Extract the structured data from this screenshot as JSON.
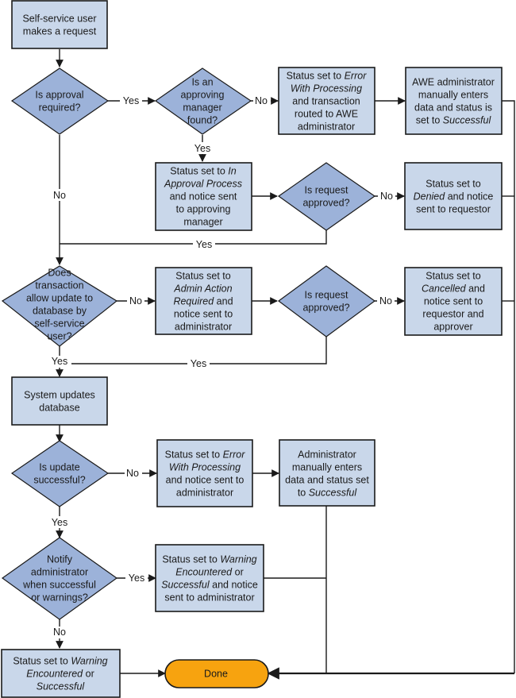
{
  "diagram": {
    "colors": {
      "process_fill": "#c9d7ea",
      "decision_fill": "#9cb2d9",
      "terminal_fill": "#f7a30f",
      "line": "#1a1a1a"
    },
    "nodes": {
      "start": {
        "lines": [
          [
            {
              "t": "Self-service user"
            }
          ],
          [
            {
              "t": "makes a request"
            }
          ]
        ]
      },
      "approval_required": {
        "lines": [
          [
            {
              "t": "Is approval"
            }
          ],
          [
            {
              "t": "required?"
            }
          ]
        ]
      },
      "manager_found": {
        "lines": [
          [
            {
              "t": "Is an"
            }
          ],
          [
            {
              "t": "approving"
            }
          ],
          [
            {
              "t": "manager"
            }
          ],
          [
            {
              "t": "found?"
            }
          ]
        ]
      },
      "error_routed": {
        "lines": [
          [
            {
              "t": "Status set to "
            },
            {
              "t": "Error",
              "i": true
            }
          ],
          [
            {
              "t": "With Processing",
              "i": true
            }
          ],
          [
            {
              "t": "and transaction"
            }
          ],
          [
            {
              "t": "routed to AWE"
            }
          ],
          [
            {
              "t": "administrator"
            }
          ]
        ]
      },
      "awe_admin_enters": {
        "lines": [
          [
            {
              "t": "AWE administrator"
            }
          ],
          [
            {
              "t": "manually enters"
            }
          ],
          [
            {
              "t": "data and status is"
            }
          ],
          [
            {
              "t": "set to "
            },
            {
              "t": "Successful",
              "i": true
            }
          ]
        ]
      },
      "in_approval": {
        "lines": [
          [
            {
              "t": "Status set to "
            },
            {
              "t": "In",
              "i": true
            }
          ],
          [
            {
              "t": "Approval Process",
              "i": true
            }
          ],
          [
            {
              "t": "and notice sent"
            }
          ],
          [
            {
              "t": "to approving"
            }
          ],
          [
            {
              "t": "manager"
            }
          ]
        ]
      },
      "request_approved_1": {
        "lines": [
          [
            {
              "t": "Is request"
            }
          ],
          [
            {
              "t": "approved?"
            }
          ]
        ]
      },
      "denied": {
        "lines": [
          [
            {
              "t": "Status set to"
            }
          ],
          [
            {
              "t": "Denied",
              "i": true
            },
            {
              "t": " and notice"
            }
          ],
          [
            {
              "t": "sent to requestor"
            }
          ]
        ]
      },
      "allow_update": {
        "lines": [
          [
            {
              "t": "Does"
            }
          ],
          [
            {
              "t": "transaction"
            }
          ],
          [
            {
              "t": "allow update to"
            }
          ],
          [
            {
              "t": "database by"
            }
          ],
          [
            {
              "t": "self-service"
            }
          ],
          [
            {
              "t": "user?"
            }
          ]
        ]
      },
      "admin_action": {
        "lines": [
          [
            {
              "t": "Status set to"
            }
          ],
          [
            {
              "t": "Admin Action",
              "i": true
            }
          ],
          [
            {
              "t": "Required",
              "i": true
            },
            {
              "t": " and"
            }
          ],
          [
            {
              "t": "notice sent to"
            }
          ],
          [
            {
              "t": "administrator"
            }
          ]
        ]
      },
      "request_approved_2": {
        "lines": [
          [
            {
              "t": "Is request"
            }
          ],
          [
            {
              "t": "approved?"
            }
          ]
        ]
      },
      "cancelled": {
        "lines": [
          [
            {
              "t": "Status set to"
            }
          ],
          [
            {
              "t": "Cancelled",
              "i": true
            },
            {
              "t": " and"
            }
          ],
          [
            {
              "t": "notice sent to"
            }
          ],
          [
            {
              "t": "requestor and"
            }
          ],
          [
            {
              "t": "approver"
            }
          ]
        ]
      },
      "system_updates": {
        "lines": [
          [
            {
              "t": "System updates"
            }
          ],
          [
            {
              "t": "database"
            }
          ]
        ]
      },
      "update_successful": {
        "lines": [
          [
            {
              "t": "Is update"
            }
          ],
          [
            {
              "t": "successful?"
            }
          ]
        ]
      },
      "error_notice": {
        "lines": [
          [
            {
              "t": "Status set to "
            },
            {
              "t": "Error",
              "i": true
            }
          ],
          [
            {
              "t": "With Processing",
              "i": true
            }
          ],
          [
            {
              "t": "and notice sent to"
            }
          ],
          [
            {
              "t": "administrator"
            }
          ]
        ]
      },
      "admin_enters": {
        "lines": [
          [
            {
              "t": "Administrator"
            }
          ],
          [
            {
              "t": "manually enters"
            }
          ],
          [
            {
              "t": "data and status set"
            }
          ],
          [
            {
              "t": "to "
            },
            {
              "t": "Successful",
              "i": true
            }
          ]
        ]
      },
      "notify_admin": {
        "lines": [
          [
            {
              "t": "Notify"
            }
          ],
          [
            {
              "t": "administrator"
            }
          ],
          [
            {
              "t": "when successful"
            }
          ],
          [
            {
              "t": "or warnings?"
            }
          ]
        ]
      },
      "warning_notice": {
        "lines": [
          [
            {
              "t": "Status set to "
            },
            {
              "t": "Warning",
              "i": true
            }
          ],
          [
            {
              "t": "Encountered",
              "i": true
            },
            {
              "t": " or"
            }
          ],
          [
            {
              "t": "Successful",
              "i": true
            },
            {
              "t": " and notice"
            }
          ],
          [
            {
              "t": "sent to administrator"
            }
          ]
        ]
      },
      "warning_status": {
        "lines": [
          [
            {
              "t": "Status set to "
            },
            {
              "t": "Warning",
              "i": true
            }
          ],
          [
            {
              "t": "Encountered",
              "i": true
            },
            {
              "t": " or"
            }
          ],
          [
            {
              "t": "Successful",
              "i": true
            }
          ]
        ]
      },
      "done": {
        "lines": [
          [
            {
              "t": "Done"
            }
          ]
        ]
      }
    },
    "edge_labels": {
      "approval_yes": "Yes",
      "approval_no": "No",
      "manager_no": "No",
      "manager_yes": "Yes",
      "approved1_no": "No",
      "approved1_yes": "Yes",
      "allow_no": "No",
      "allow_yes": "Yes",
      "approved2_no": "No",
      "approved2_yes": "Yes",
      "update_no": "No",
      "update_yes": "Yes",
      "notify_yes": "Yes",
      "notify_no": "No"
    }
  }
}
